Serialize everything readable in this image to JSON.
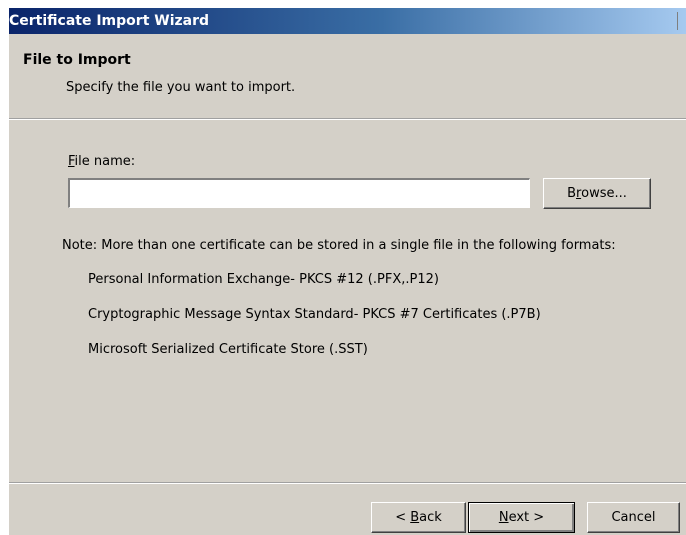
{
  "window": {
    "title": "Certificate Import Wizard"
  },
  "header": {
    "title": "File to Import",
    "subtitle": "Specify the file you want to import."
  },
  "form": {
    "file_label_accel": "F",
    "file_label_rest": "ile name:",
    "file_value": "",
    "browse_label_pre": "B",
    "browse_label_accel": "r",
    "browse_label_post": "owse..."
  },
  "note": {
    "text": "Note: More than one certificate can be stored in a single file in the following formats:",
    "formats": [
      "Personal Information Exchange- PKCS #12 (.PFX,.P12)",
      "Cryptographic Message Syntax Standard- PKCS #7 Certificates (.P7B)",
      "Microsoft Serialized Certificate Store (.SST)"
    ]
  },
  "footer": {
    "back_pre": "< ",
    "back_accel": "B",
    "back_post": "ack",
    "next_accel": "N",
    "next_post": "ext >",
    "cancel_label": "Cancel"
  }
}
